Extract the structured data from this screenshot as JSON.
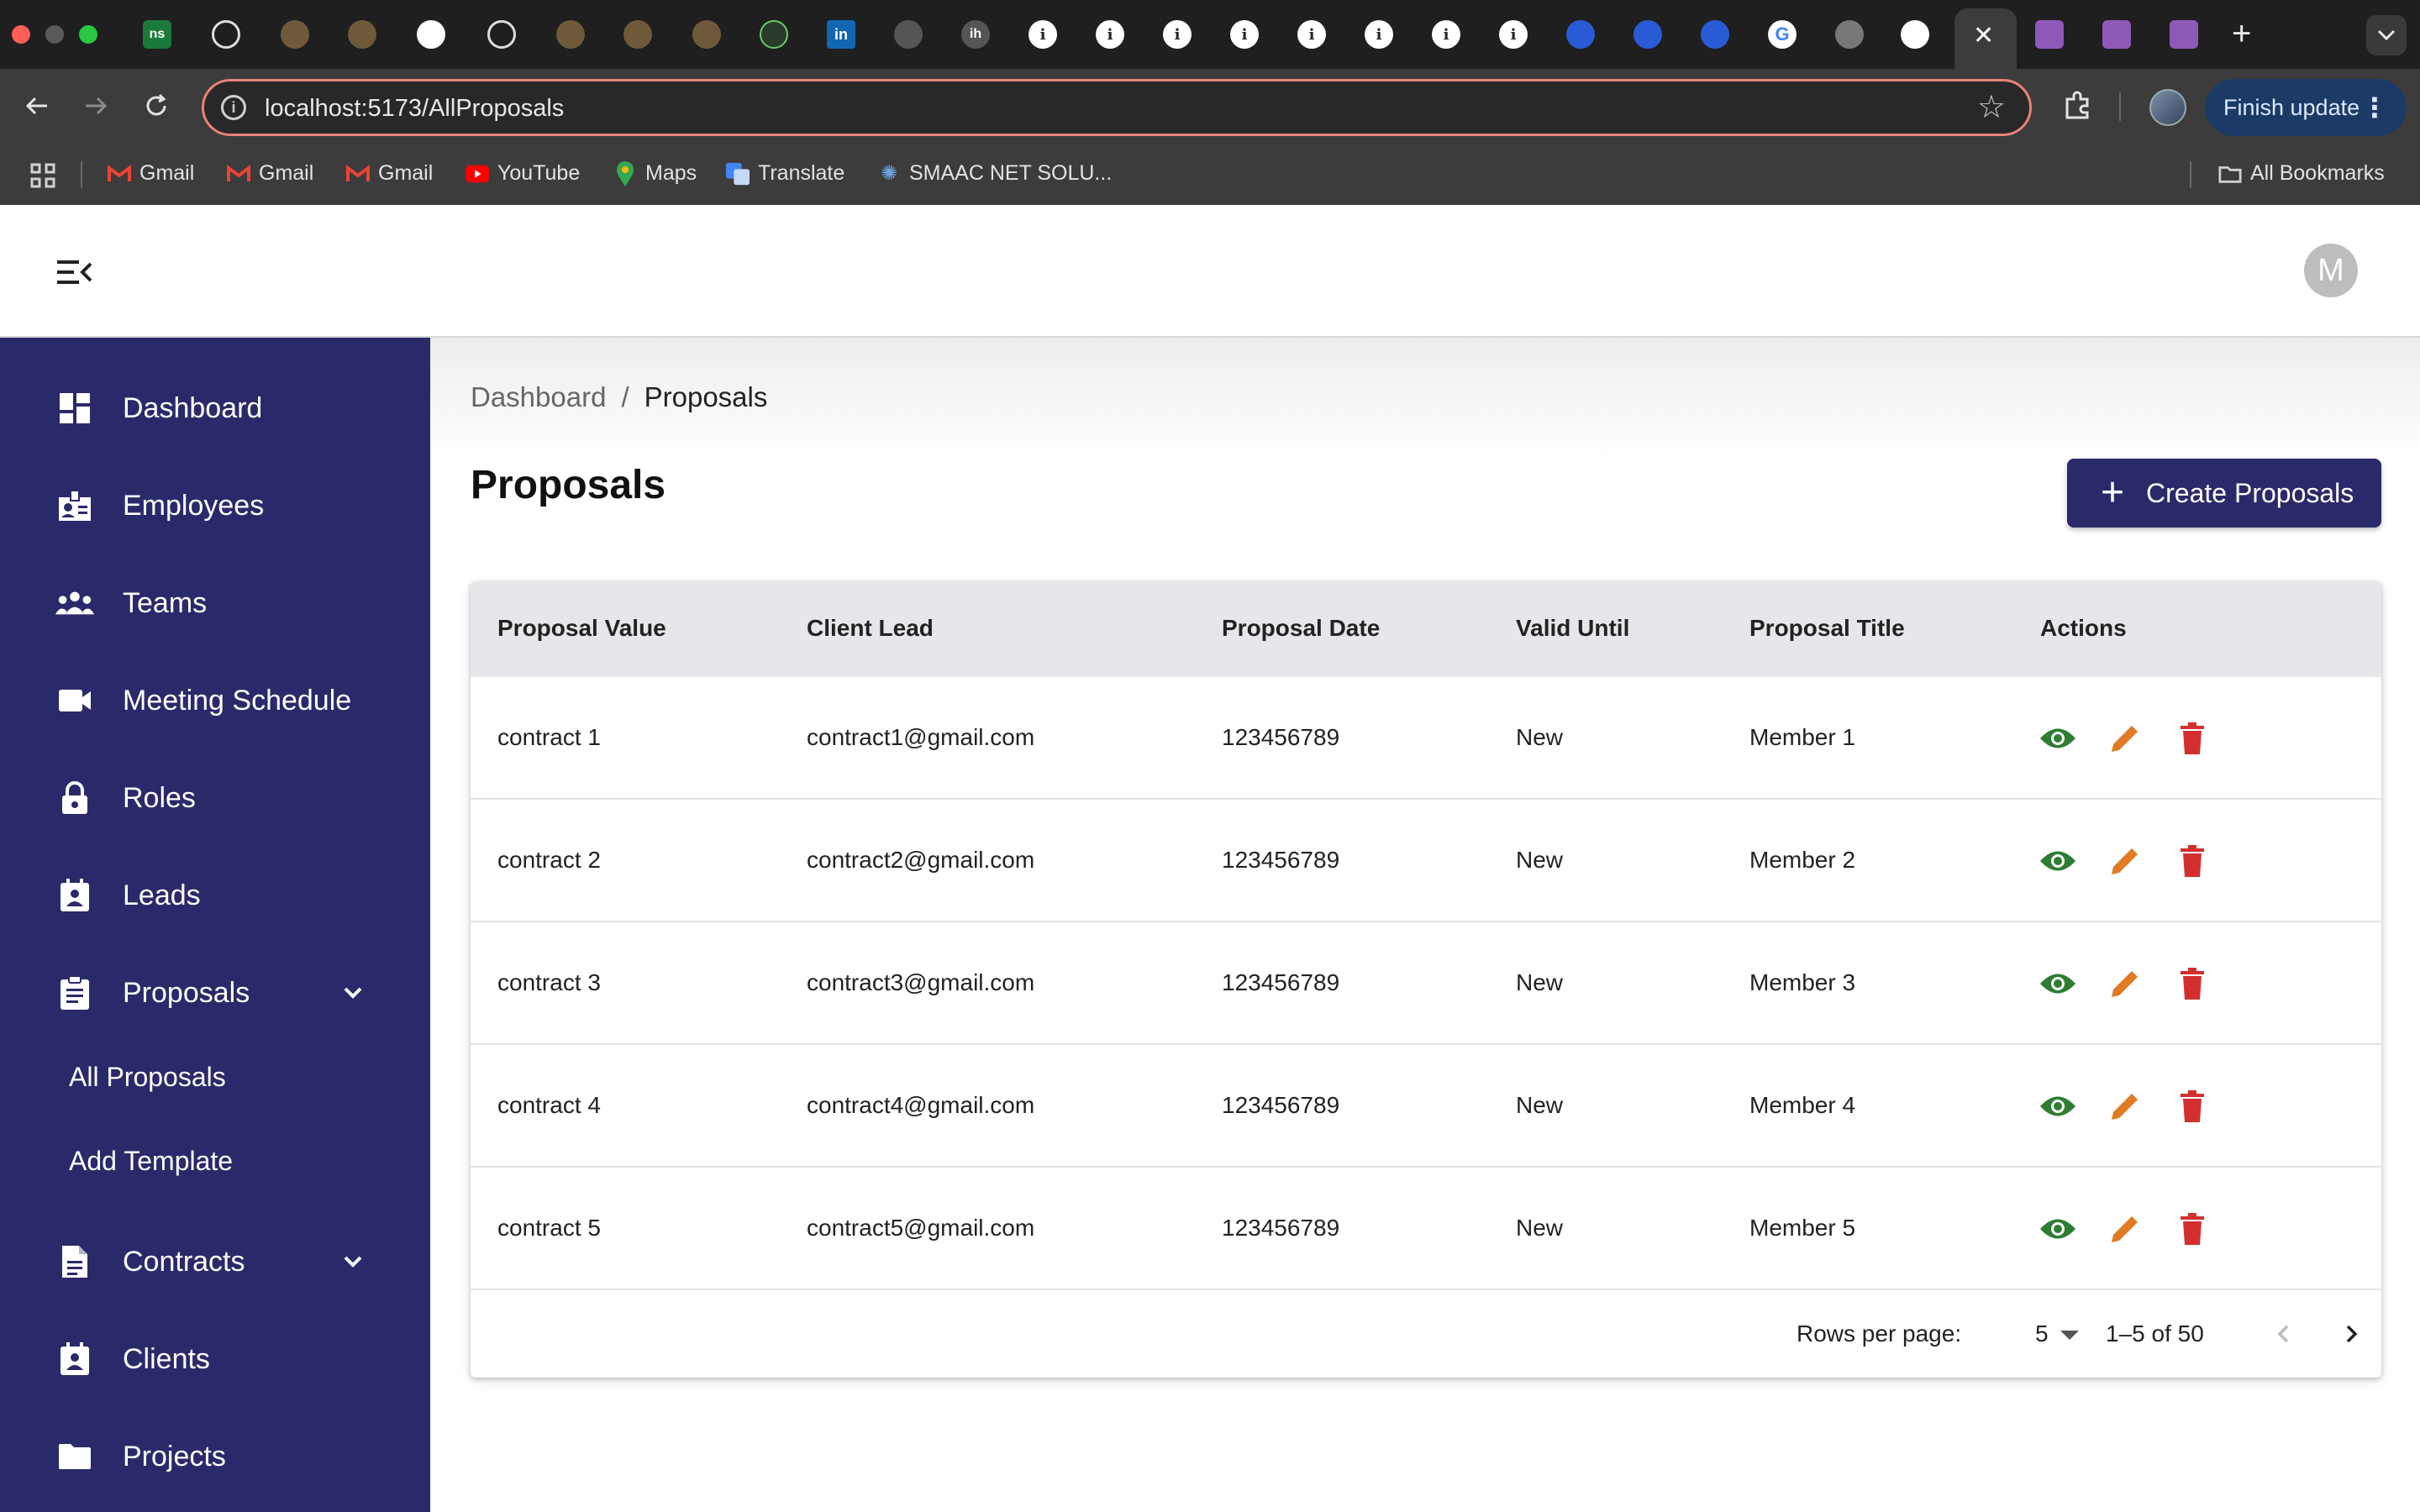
{
  "browser": {
    "url": "localhost:5173/AllProposals",
    "finish_update": "Finish update",
    "bookmarks": [
      {
        "label": "Gmail",
        "icon": "gmail-icon"
      },
      {
        "label": "Gmail",
        "icon": "gmail-icon"
      },
      {
        "label": "Gmail",
        "icon": "gmail-icon"
      },
      {
        "label": "YouTube",
        "icon": "youtube-icon"
      },
      {
        "label": "Maps",
        "icon": "maps-icon"
      },
      {
        "label": "Translate",
        "icon": "translate-icon"
      },
      {
        "label": "SMAAC NET SOLU...",
        "icon": "gear-icon"
      }
    ],
    "all_bookmarks": "All Bookmarks",
    "tab_badge_ns": "ns",
    "tab_badge_in": "in",
    "tab_badge_ih": "ih"
  },
  "header": {
    "avatar_initial": "M"
  },
  "sidebar": {
    "items": [
      {
        "label": "Dashboard",
        "icon": "dashboard-icon"
      },
      {
        "label": "Employees",
        "icon": "badge-icon"
      },
      {
        "label": "Teams",
        "icon": "groups-icon"
      },
      {
        "label": "Meeting Schedule",
        "icon": "videocam-icon"
      },
      {
        "label": "Roles",
        "icon": "lock-icon"
      },
      {
        "label": "Leads",
        "icon": "contact-icon"
      },
      {
        "label": "Proposals",
        "icon": "clipboard-icon"
      },
      {
        "label": "Contracts",
        "icon": "document-icon"
      },
      {
        "label": "Clients",
        "icon": "contact-icon"
      },
      {
        "label": "Projects",
        "icon": "folder-icon"
      }
    ],
    "proposals_sub": [
      "All Proposals",
      "Add Template"
    ]
  },
  "main": {
    "breadcrumb": {
      "root": "Dashboard",
      "separator": "/",
      "current": "Proposals"
    },
    "title": "Proposals",
    "create_button": "Create Proposals",
    "table": {
      "columns": [
        "Proposal Value",
        "Client Lead",
        "Proposal Date",
        "Valid Until",
        "Proposal Title",
        "Actions"
      ],
      "rows": [
        [
          "contract 1",
          "contract1@gmail.com",
          "123456789",
          "New",
          "Member 1"
        ],
        [
          "contract 2",
          "contract2@gmail.com",
          "123456789",
          "New",
          "Member 2"
        ],
        [
          "contract 3",
          "contract3@gmail.com",
          "123456789",
          "New",
          "Member 3"
        ],
        [
          "contract 4",
          "contract4@gmail.com",
          "123456789",
          "New",
          "Member 4"
        ],
        [
          "contract 5",
          "contract5@gmail.com",
          "123456789",
          "New",
          "Member 5"
        ]
      ]
    },
    "pagination": {
      "rows_per_page_label": "Rows per page:",
      "rows_per_page": "5",
      "range": "1–5 of 50"
    }
  },
  "colors": {
    "sidebar": "#2a2a6a",
    "view": "#2e7d32",
    "edit": "#e07b24",
    "delete": "#d32f2f"
  }
}
